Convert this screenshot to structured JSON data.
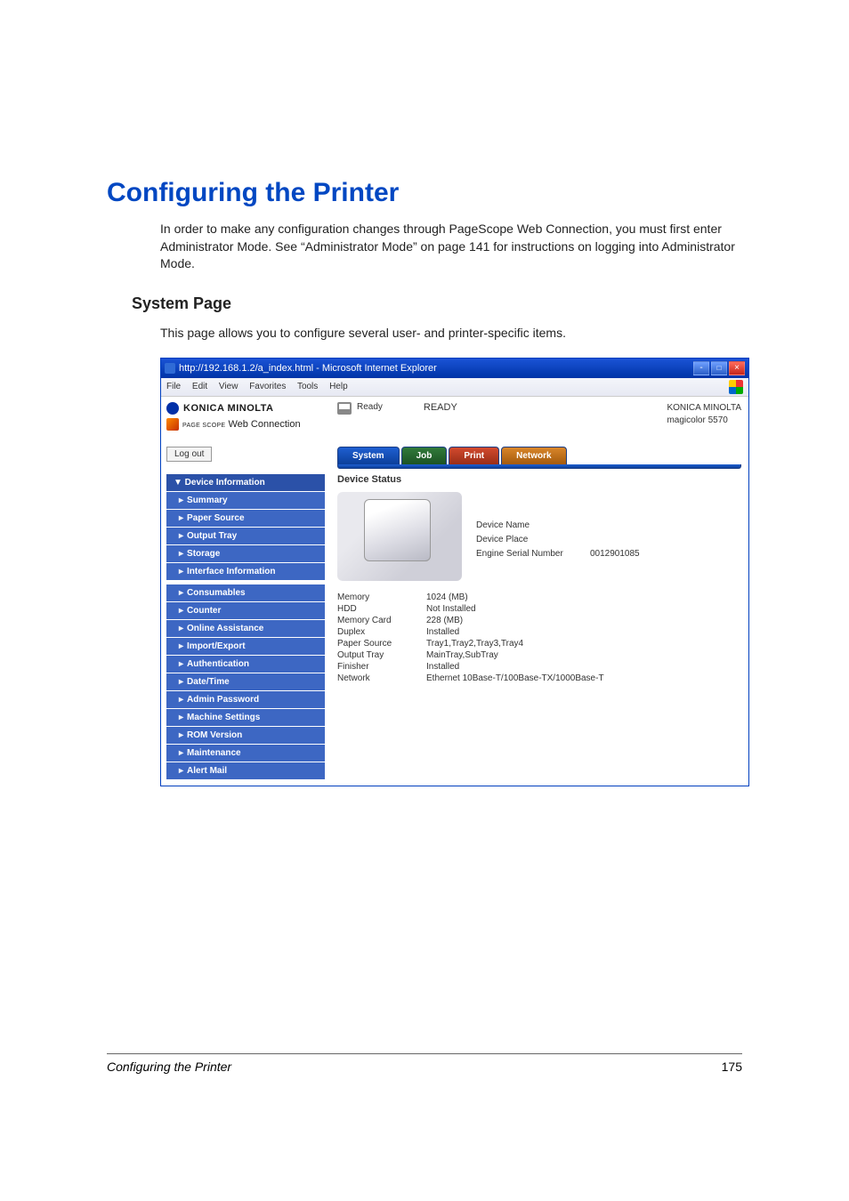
{
  "heading": "Configuring the Printer",
  "intro": "In order to make any configuration changes through PageScope Web Con­nection, you must first enter Administrator Mode. See “Administrator Mode” on page 141 for instructions on logging into Administrator Mode.",
  "subheading": "System Page",
  "subintro": "This page allows you to configure several user- and printer-specific items.",
  "browser": {
    "title": "http://192.168.1.2/a_index.html - Microsoft Internet Explorer",
    "menu": {
      "file": "File",
      "edit": "Edit",
      "view": "View",
      "favorites": "Favorites",
      "tools": "Tools",
      "help": "Help"
    }
  },
  "brand": {
    "name": "KONICA MINOLTA",
    "pagescope_prefix": "PAGE SCOPE",
    "pagescope": "Web Connection"
  },
  "logout": "Log out",
  "nav": {
    "group": "▼ Device Information",
    "items": [
      "Summary",
      "Paper Source",
      "Output Tray",
      "Storage",
      "Interface Information",
      "Consumables",
      "Counter",
      "Online Assistance",
      "Import/Export",
      "Authentication",
      "Date/Time",
      "Admin Password",
      "Machine Settings",
      "ROM Version",
      "Maintenance",
      "Alert Mail"
    ]
  },
  "status": {
    "ready_small": "Ready",
    "ready_big": "READY"
  },
  "product": {
    "maker": "KONICA MINOLTA",
    "model": "magicolor 5570"
  },
  "tabs": {
    "system": "System",
    "job": "Job",
    "print": "Print",
    "network": "Network"
  },
  "panel_title": "Device Status",
  "device": {
    "name_label": "Device Name",
    "place_label": "Device Place",
    "serial_label": "Engine Serial Number",
    "serial_value": "0012901085"
  },
  "specs": [
    {
      "k": "Memory",
      "v": "1024 (MB)"
    },
    {
      "k": "HDD",
      "v": "Not Installed"
    },
    {
      "k": "Memory Card",
      "v": "228 (MB)"
    },
    {
      "k": "Duplex",
      "v": "Installed"
    },
    {
      "k": "Paper Source",
      "v": "Tray1,Tray2,Tray3,Tray4"
    },
    {
      "k": "Output Tray",
      "v": "MainTray,SubTray"
    },
    {
      "k": "Finisher",
      "v": "Installed"
    },
    {
      "k": "Network",
      "v": "Ethernet 10Base-T/100Base-TX/1000Base-T"
    }
  ],
  "footer": {
    "text": "Configuring the Printer",
    "page": "175"
  }
}
